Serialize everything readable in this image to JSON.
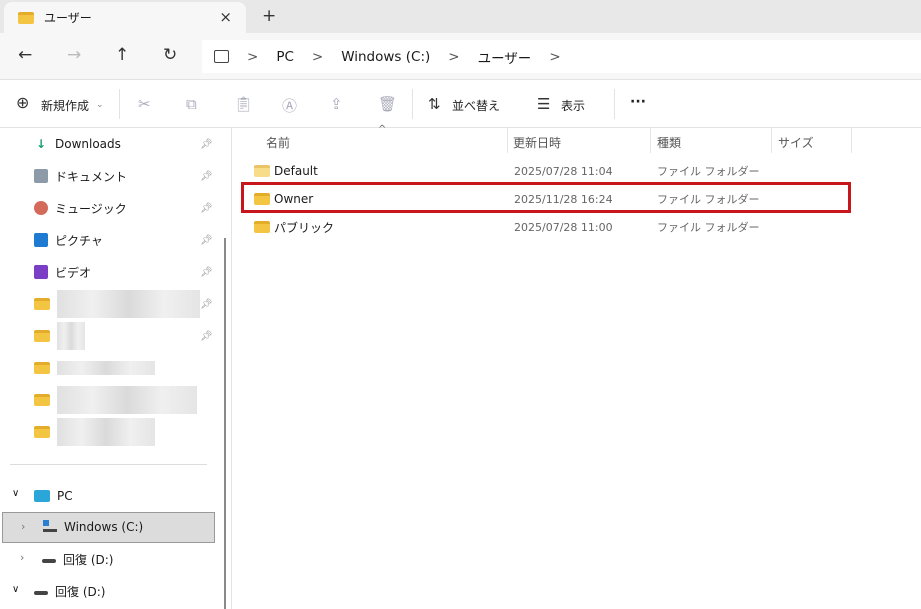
{
  "tab": {
    "title": "ユーザー",
    "close": "×",
    "new": "+"
  },
  "nav": {
    "back": "←",
    "forward": "→",
    "up": "↑",
    "refresh": "↻",
    "breadcrumb": [
      "PC",
      "Windows (C:)",
      "ユーザー"
    ],
    "sep": ">"
  },
  "toolbar": {
    "new_label": "新規作成",
    "sort_label": "並べ替え",
    "view_label": "表示",
    "more": "···"
  },
  "sidebar": {
    "quick": [
      {
        "label": "Downloads"
      },
      {
        "label": "ドキュメント"
      },
      {
        "label": "ミュージック"
      },
      {
        "label": "ピクチャ"
      },
      {
        "label": "ビデオ"
      }
    ],
    "pc": "PC",
    "drive_c": "Windows (C:)",
    "drive_d": "回復 (D:)",
    "drive_d2": "回復 (D:)"
  },
  "columns": {
    "name": "名前",
    "date": "更新日時",
    "type": "種類",
    "size": "サイズ"
  },
  "files": [
    {
      "name": "Default",
      "date": "2025/07/28 11:04",
      "type": "ファイル フォルダー"
    },
    {
      "name": "Owner",
      "date": "2025/11/28 16:24",
      "type": "ファイル フォルダー"
    },
    {
      "name": "パブリック",
      "date": "2025/07/28 11:00",
      "type": "ファイル フォルダー"
    }
  ],
  "colors": {
    "highlight": "#c8161d"
  }
}
